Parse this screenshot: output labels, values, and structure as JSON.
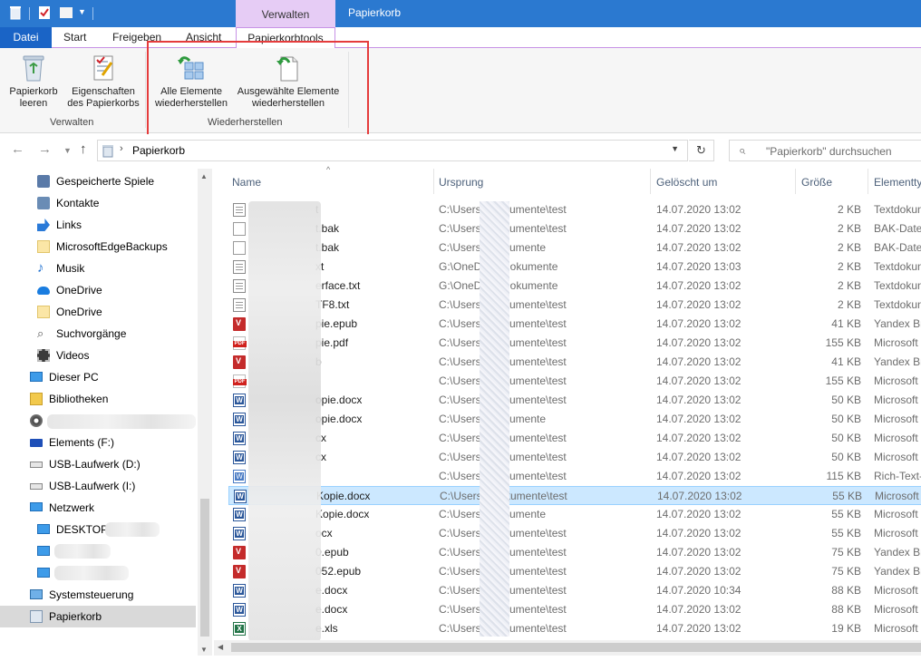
{
  "window": {
    "title": "Papierkorb",
    "context_group": "Verwalten"
  },
  "ribbon": {
    "tabs": {
      "datei": "Datei",
      "start": "Start",
      "freigeben": "Freigeben",
      "ansicht": "Ansicht",
      "papierkorbtools": "Papierkorbtools"
    },
    "buttons": {
      "empty_line1": "Papierkorb",
      "empty_line2": "leeren",
      "props_line1": "Eigenschaften",
      "props_line2": "des Papierkorbs",
      "restore_all_line1": "Alle Elemente",
      "restore_all_line2": "wiederherstellen",
      "restore_sel_line1": "Ausgewählte Elemente",
      "restore_sel_line2": "wiederherstellen"
    },
    "groups": {
      "verwalten": "Verwalten",
      "wiederherstellen": "Wiederherstellen"
    }
  },
  "address": {
    "path": "Papierkorb",
    "search_placeholder": "\"Papierkorb\" durchsuchen"
  },
  "nav_pane": {
    "items": [
      {
        "label": "Gespeicherte Spiele",
        "icon": "saved-games-icon"
      },
      {
        "label": "Kontakte",
        "icon": "contacts-icon"
      },
      {
        "label": "Links",
        "icon": "links-icon"
      },
      {
        "label": "MicrosoftEdgeBackups",
        "icon": "folder-icon"
      },
      {
        "label": "Musik",
        "icon": "music-icon"
      },
      {
        "label": "OneDrive",
        "icon": "onedrive-icon"
      },
      {
        "label": "OneDrive",
        "icon": "folder-icon"
      },
      {
        "label": "Suchvorgänge",
        "icon": "search-icon"
      },
      {
        "label": "Videos",
        "icon": "videos-icon"
      },
      {
        "label": "Dieser PC",
        "icon": "pc-icon"
      },
      {
        "label": "Bibliotheken",
        "icon": "libraries-icon"
      },
      {
        "label": "",
        "icon": "disc-icon"
      },
      {
        "label": "Elements (F:)",
        "icon": "drive-icon"
      },
      {
        "label": "USB-Laufwerk (D:)",
        "icon": "usb-drive-icon"
      },
      {
        "label": "USB-Laufwerk (I:)",
        "icon": "usb-drive-icon"
      },
      {
        "label": "Netzwerk",
        "icon": "network-icon"
      },
      {
        "label": "DESKTOP-",
        "icon": "computer-icon"
      },
      {
        "label": "",
        "icon": "computer-icon"
      },
      {
        "label": "",
        "icon": "computer-icon"
      },
      {
        "label": "Systemsteuerung",
        "icon": "control-panel-icon"
      },
      {
        "label": "Papierkorb",
        "icon": "recycle-bin-icon"
      }
    ]
  },
  "columns": {
    "name": "Name",
    "origin": "Ursprung",
    "deleted": "Gelöscht um",
    "size": "Größe",
    "type": "Elementty"
  },
  "files": [
    {
      "name": "t",
      "origin": "C:\\Users\\       \\Dokumente\\test",
      "deleted": "14.07.2020 13:02",
      "size": "2 KB",
      "type": "Textdokun",
      "icon": "txt"
    },
    {
      "name": "t.bak",
      "origin": "C:\\Users\\       \\Dokumente\\test",
      "deleted": "14.07.2020 13:02",
      "size": "2 KB",
      "type": "BAK-Date",
      "icon": "blank"
    },
    {
      "name": "t.bak",
      "origin": "C:\\Users\\       \\Dokumente",
      "deleted": "14.07.2020 13:02",
      "size": "2 KB",
      "type": "BAK-Date",
      "icon": "blank"
    },
    {
      "name": "xt",
      "origin": "G:\\OneDrive\\Dokumente",
      "deleted": "14.07.2020 13:03",
      "size": "2 KB",
      "type": "Textdokun",
      "icon": "txt"
    },
    {
      "name": "erface.txt",
      "origin": "G:\\OneDrive\\Dokumente",
      "deleted": "14.07.2020 13:02",
      "size": "2 KB",
      "type": "Textdokun",
      "icon": "txt"
    },
    {
      "name": "TF8.txt",
      "origin": "C:\\Users\\       \\Dokumente\\test",
      "deleted": "14.07.2020 13:02",
      "size": "2 KB",
      "type": "Textdokun",
      "icon": "txt"
    },
    {
      "name": "pie.epub",
      "origin": "C:\\Users\\       \\Dokumente\\test",
      "deleted": "14.07.2020 13:02",
      "size": "41 KB",
      "type": "Yandex Br",
      "icon": "epub"
    },
    {
      "name": "pie.pdf",
      "origin": "C:\\Users\\       \\Dokumente\\test",
      "deleted": "14.07.2020 13:02",
      "size": "155 KB",
      "type": "Microsoft",
      "icon": "pdf"
    },
    {
      "name": "b",
      "origin": "C:\\Users\\       \\Dokumente\\test",
      "deleted": "14.07.2020 13:02",
      "size": "41 KB",
      "type": "Yandex Br",
      "icon": "epub"
    },
    {
      "name": "",
      "origin": "C:\\Users\\       \\Dokumente\\test",
      "deleted": "14.07.2020 13:02",
      "size": "155 KB",
      "type": "Microsoft",
      "icon": "pdf"
    },
    {
      "name": "opie.docx",
      "origin": "C:\\Users\\       \\Dokumente\\test",
      "deleted": "14.07.2020 13:02",
      "size": "50 KB",
      "type": "Microsoft",
      "icon": "docx"
    },
    {
      "name": "opie.docx",
      "origin": "C:\\Users\\       \\Dokumente",
      "deleted": "14.07.2020 13:02",
      "size": "50 KB",
      "type": "Microsoft",
      "icon": "docx"
    },
    {
      "name": "cx",
      "origin": "C:\\Users\\       \\Dokumente\\test",
      "deleted": "14.07.2020 13:02",
      "size": "50 KB",
      "type": "Microsoft",
      "icon": "docx"
    },
    {
      "name": "cx",
      "origin": "C:\\Users\\       \\Dokumente\\test",
      "deleted": "14.07.2020 13:02",
      "size": "50 KB",
      "type": "Microsoft",
      "icon": "docx"
    },
    {
      "name": "",
      "origin": "C:\\Users\\       \\Dokumente\\test",
      "deleted": "14.07.2020 13:02",
      "size": "115 KB",
      "type": "Rich-Text-",
      "icon": "rtf"
    },
    {
      "name": "Kopie.docx",
      "origin": "C:\\Users\\       \\Dokumente\\test",
      "deleted": "14.07.2020 13:02",
      "size": "55 KB",
      "type": "Microsoft",
      "icon": "docx",
      "selected": true
    },
    {
      "name": "Kopie.docx",
      "origin": "C:\\Users\\       \\Dokumente",
      "deleted": "14.07.2020 13:02",
      "size": "55 KB",
      "type": "Microsoft",
      "icon": "docx"
    },
    {
      "name": "ocx",
      "origin": "C:\\Users\\       \\Dokumente\\test",
      "deleted": "14.07.2020 13:02",
      "size": "55 KB",
      "type": "Microsoft",
      "icon": "docx"
    },
    {
      "name": "0.epub",
      "origin": "C:\\Users\\       \\Dokumente\\test",
      "deleted": "14.07.2020 13:02",
      "size": "75 KB",
      "type": "Yandex Br",
      "icon": "epub"
    },
    {
      "name": "052.epub",
      "origin": "C:\\Users\\       \\Dokumente\\test",
      "deleted": "14.07.2020 13:02",
      "size": "75 KB",
      "type": "Yandex Br",
      "icon": "epub"
    },
    {
      "name": "e.docx",
      "origin": "C:\\Users\\       \\Dokumente\\test",
      "deleted": "14.07.2020 10:34",
      "size": "88 KB",
      "type": "Microsoft",
      "icon": "docx"
    },
    {
      "name": "e.docx",
      "origin": "C:\\Users\\       \\Dokumente\\test",
      "deleted": "14.07.2020 13:02",
      "size": "88 KB",
      "type": "Microsoft",
      "icon": "docx"
    },
    {
      "name": "e.xls",
      "origin": "C:\\Users\\       \\Dokumente\\test",
      "deleted": "14.07.2020 13:02",
      "size": "19 KB",
      "type": "Microsoft",
      "icon": "xls"
    }
  ]
}
